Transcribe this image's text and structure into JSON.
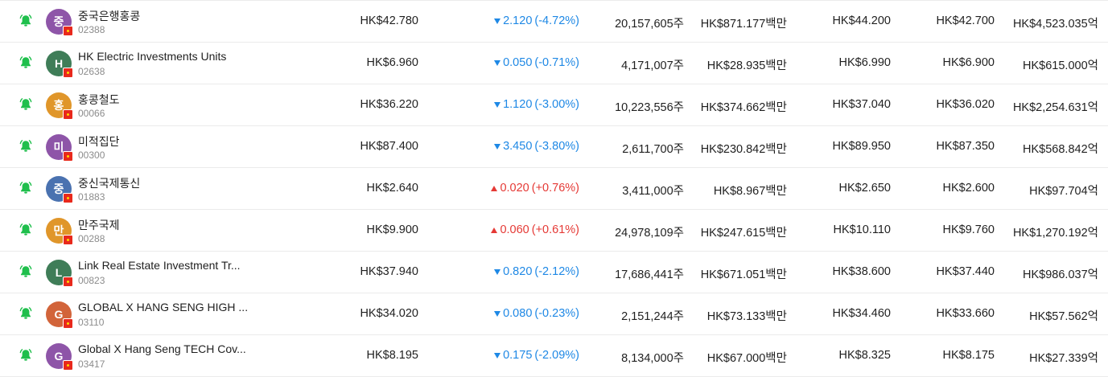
{
  "colors": {
    "down": "#1e88e5",
    "up": "#e53935",
    "bell": "#1fbf4c"
  },
  "rows": [
    {
      "name": "중국은행홍콩",
      "code": "02388",
      "avatar": "중",
      "avatar_color": "#8e55a8",
      "price": "HK$42.780",
      "direction": "down",
      "change": "2.120",
      "change_pct": "(-4.72%)",
      "volume": "20,157,605주",
      "amount": "HK$871.177백만",
      "high": "HK$44.200",
      "low": "HK$42.700",
      "market_cap": "HK$4,523.035억"
    },
    {
      "name": "HK Electric Investments Units",
      "code": "02638",
      "avatar": "H",
      "avatar_color": "#3f7d58",
      "price": "HK$6.960",
      "direction": "down",
      "change": "0.050",
      "change_pct": "(-0.71%)",
      "volume": "4,171,007주",
      "amount": "HK$28.935백만",
      "high": "HK$6.990",
      "low": "HK$6.900",
      "market_cap": "HK$615.000억"
    },
    {
      "name": "홍콩철도",
      "code": "00066",
      "avatar": "홍",
      "avatar_color": "#e0962a",
      "price": "HK$36.220",
      "direction": "down",
      "change": "1.120",
      "change_pct": "(-3.00%)",
      "volume": "10,223,556주",
      "amount": "HK$374.662백만",
      "high": "HK$37.040",
      "low": "HK$36.020",
      "market_cap": "HK$2,254.631억"
    },
    {
      "name": "미적집단",
      "code": "00300",
      "avatar": "미",
      "avatar_color": "#8e55a8",
      "price": "HK$87.400",
      "direction": "down",
      "change": "3.450",
      "change_pct": "(-3.80%)",
      "volume": "2,611,700주",
      "amount": "HK$230.842백만",
      "high": "HK$89.950",
      "low": "HK$87.350",
      "market_cap": "HK$568.842억"
    },
    {
      "name": "중신국제통신",
      "code": "01883",
      "avatar": "중",
      "avatar_color": "#4a72b0",
      "price": "HK$2.640",
      "direction": "up",
      "change": "0.020",
      "change_pct": "(+0.76%)",
      "volume": "3,411,000주",
      "amount": "HK$8.967백만",
      "high": "HK$2.650",
      "low": "HK$2.600",
      "market_cap": "HK$97.704억"
    },
    {
      "name": "만주국제",
      "code": "00288",
      "avatar": "만",
      "avatar_color": "#e0962a",
      "price": "HK$9.900",
      "direction": "up",
      "change": "0.060",
      "change_pct": "(+0.61%)",
      "volume": "24,978,109주",
      "amount": "HK$247.615백만",
      "high": "HK$10.110",
      "low": "HK$9.760",
      "market_cap": "HK$1,270.192억"
    },
    {
      "name": "Link Real Estate Investment Tr...",
      "code": "00823",
      "avatar": "L",
      "avatar_color": "#3f7d58",
      "price": "HK$37.940",
      "direction": "down",
      "change": "0.820",
      "change_pct": "(-2.12%)",
      "volume": "17,686,441주",
      "amount": "HK$671.051백만",
      "high": "HK$38.600",
      "low": "HK$37.440",
      "market_cap": "HK$986.037억"
    },
    {
      "name": "GLOBAL X HANG SENG HIGH ...",
      "code": "03110",
      "avatar": "G",
      "avatar_color": "#d2643a",
      "price": "HK$34.020",
      "direction": "down",
      "change": "0.080",
      "change_pct": "(-0.23%)",
      "volume": "2,151,244주",
      "amount": "HK$73.133백만",
      "high": "HK$34.460",
      "low": "HK$33.660",
      "market_cap": "HK$57.562억"
    },
    {
      "name": "Global X Hang Seng TECH Cov...",
      "code": "03417",
      "avatar": "G",
      "avatar_color": "#8e55a8",
      "price": "HK$8.195",
      "direction": "down",
      "change": "0.175",
      "change_pct": "(-2.09%)",
      "volume": "8,134,000주",
      "amount": "HK$67.000백만",
      "high": "HK$8.325",
      "low": "HK$8.175",
      "market_cap": "HK$27.339억"
    }
  ]
}
